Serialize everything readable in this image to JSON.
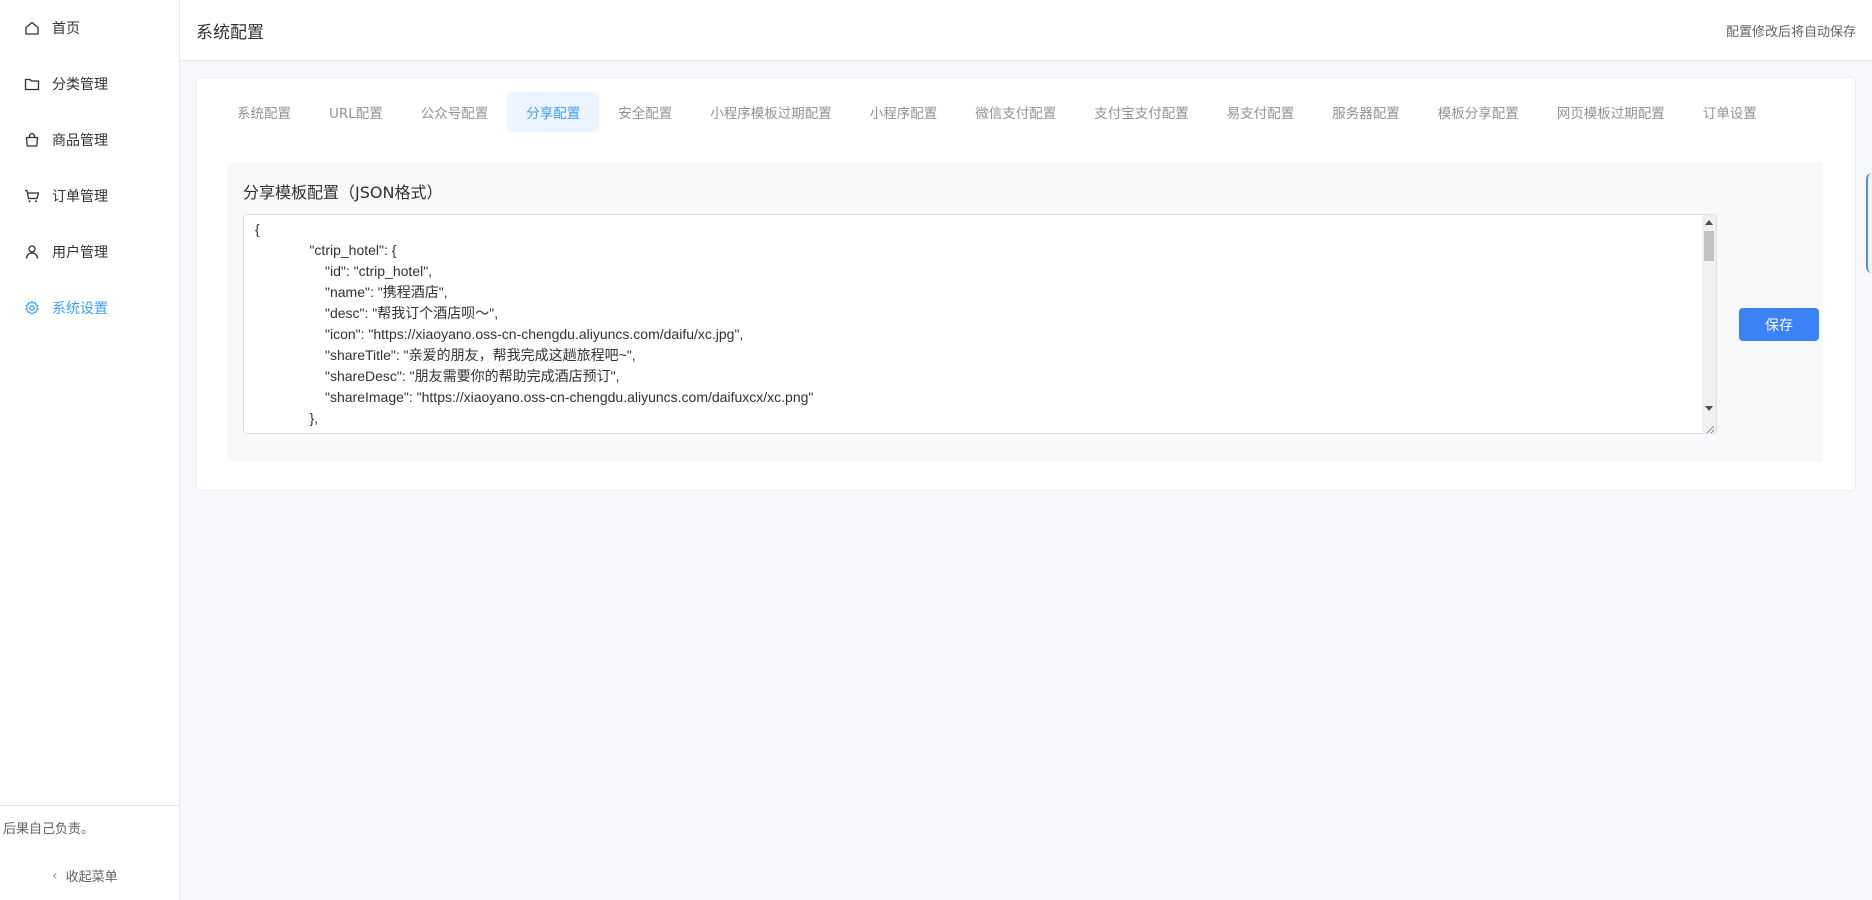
{
  "sidebar": {
    "items": [
      {
        "label": "首页",
        "icon": "home-icon",
        "active": false
      },
      {
        "label": "分类管理",
        "icon": "folder-icon",
        "active": false
      },
      {
        "label": "商品管理",
        "icon": "shopping-bag-icon",
        "active": false
      },
      {
        "label": "订单管理",
        "icon": "cart-icon",
        "active": false
      },
      {
        "label": "用户管理",
        "icon": "user-icon",
        "active": false
      },
      {
        "label": "系统设置",
        "icon": "gear-icon",
        "active": true
      }
    ],
    "notice": "后果自己负责。",
    "collapse_label": "收起菜单"
  },
  "header": {
    "title": "系统配置",
    "autosave_note": "配置修改后将自动保存"
  },
  "tabs": [
    {
      "label": "系统配置",
      "active": false
    },
    {
      "label": "URL配置",
      "active": false
    },
    {
      "label": "公众号配置",
      "active": false
    },
    {
      "label": "分享配置",
      "active": true
    },
    {
      "label": "安全配置",
      "active": false
    },
    {
      "label": "小程序模板过期配置",
      "active": false
    },
    {
      "label": "小程序配置",
      "active": false
    },
    {
      "label": "微信支付配置",
      "active": false
    },
    {
      "label": "支付宝支付配置",
      "active": false
    },
    {
      "label": "易支付配置",
      "active": false
    },
    {
      "label": "服务器配置",
      "active": false
    },
    {
      "label": "模板分享配置",
      "active": false
    },
    {
      "label": "网页模板过期配置",
      "active": false
    },
    {
      "label": "订单设置",
      "active": false
    }
  ],
  "share_config": {
    "label": "分享模板配置（JSON格式）",
    "json_lines": [
      "{",
      "              \"ctrip_hotel\": {",
      "                  \"id\": \"ctrip_hotel\",",
      "                  \"name\": \"携程酒店\",",
      "                  \"desc\": \"帮我订个酒店呗～\",",
      "                  \"icon\": \"https://xiaoyano.oss-cn-chengdu.aliyuncs.com/daifu/xc.jpg\",",
      "                  \"shareTitle\": \"亲爱的朋友，帮我完成这趟旅程吧~\",",
      "                  \"shareDesc\": \"朋友需要你的帮助完成酒店预订\",",
      "                  \"shareImage\": \"https://xiaoyano.oss-cn-chengdu.aliyuncs.com/daifuxcx/xc.png\"",
      "              },"
    ],
    "save_label": "保存"
  },
  "colors": {
    "accent": "#409eff",
    "button": "#3b82f6",
    "background": "#f5f7fa"
  }
}
